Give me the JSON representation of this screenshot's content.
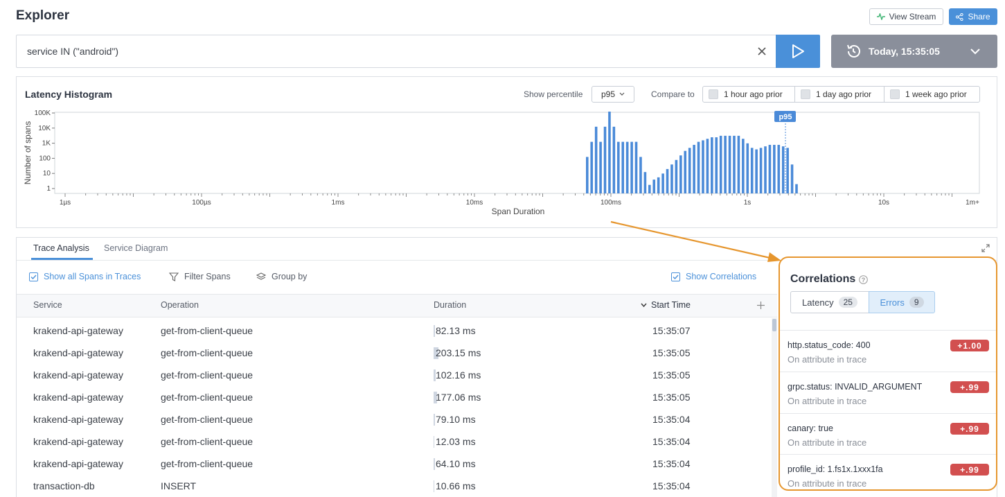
{
  "page": {
    "title": "Explorer"
  },
  "header": {
    "view_stream": "View Stream",
    "share": "Share"
  },
  "query": {
    "value": "service IN (\"android\")"
  },
  "time_range": {
    "label": "Today, 15:35:05"
  },
  "histogram": {
    "title": "Latency Histogram",
    "show_percentile_label": "Show percentile",
    "percentile_value": "p95",
    "compare_label": "Compare to",
    "compare_options": [
      "1 hour ago prior",
      "1 day ago prior",
      "1 week ago prior"
    ],
    "marker_label": "p95",
    "chart_data": {
      "type": "bar",
      "title": "",
      "xlabel": "Span Duration",
      "ylabel": "Number of spans",
      "y_scale": "log",
      "x_scale": "log",
      "y_ticks": [
        "100K",
        "10K",
        "1K",
        "100",
        "10",
        "1"
      ],
      "x_ticks": [
        "1µs",
        "100µs",
        "1ms",
        "10ms",
        "100ms",
        "1s",
        "10s",
        "1m+"
      ],
      "percentile_marker": {
        "label": "p95",
        "x": "≈2.1s"
      },
      "series": [
        {
          "values": [
            2,
            3,
            4,
            3,
            4,
            5,
            4,
            3,
            3,
            3,
            3,
            3,
            2,
            1,
            0.15,
            0.5,
            0.65,
            0.9,
            1.2,
            1.5,
            1.8,
            2.1,
            2.4,
            2.6,
            2.8,
            3.0,
            3.1,
            3.2,
            3.3,
            3.3,
            3.4,
            3.4,
            3.4,
            3.4,
            3.4,
            3.2,
            2.9,
            2.6,
            2.5,
            2.6,
            2.7,
            2.8,
            2.8,
            2.8,
            2.7,
            2.6,
            1.5,
            0.2
          ]
        }
      ]
    }
  },
  "tabs": [
    "Trace Analysis",
    "Service Diagram"
  ],
  "toolbar": {
    "show_all_spans": "Show all Spans in Traces",
    "filter_spans": "Filter Spans",
    "group_by": "Group by",
    "show_correlations": "Show Correlations"
  },
  "table": {
    "columns": {
      "service": "Service",
      "operation": "Operation",
      "duration": "Duration",
      "start_time": "Start Time"
    },
    "rows": [
      {
        "service": "krakend-api-gateway",
        "operation": "get-from-client-queue",
        "duration": "82.13 ms",
        "start_time": "15:35:07"
      },
      {
        "service": "krakend-api-gateway",
        "operation": "get-from-client-queue",
        "duration": "203.15 ms",
        "start_time": "15:35:05"
      },
      {
        "service": "krakend-api-gateway",
        "operation": "get-from-client-queue",
        "duration": "102.16 ms",
        "start_time": "15:35:05"
      },
      {
        "service": "krakend-api-gateway",
        "operation": "get-from-client-queue",
        "duration": "177.06 ms",
        "start_time": "15:35:05"
      },
      {
        "service": "krakend-api-gateway",
        "operation": "get-from-client-queue",
        "duration": "79.10 ms",
        "start_time": "15:35:04"
      },
      {
        "service": "krakend-api-gateway",
        "operation": "get-from-client-queue",
        "duration": "12.03 ms",
        "start_time": "15:35:04"
      },
      {
        "service": "krakend-api-gateway",
        "operation": "get-from-client-queue",
        "duration": "64.10 ms",
        "start_time": "15:35:04"
      },
      {
        "service": "transaction-db",
        "operation": "INSERT",
        "duration": "10.66 ms",
        "start_time": "15:35:04"
      }
    ]
  },
  "correlations": {
    "title": "Correlations",
    "tabs": [
      {
        "label": "Latency",
        "count": "25"
      },
      {
        "label": "Errors",
        "count": "9"
      }
    ],
    "items": [
      {
        "name": "http.status_code: 400",
        "sub": "On attribute in trace",
        "score": "+1.00"
      },
      {
        "name": "grpc.status: INVALID_ARGUMENT",
        "sub": "On attribute in trace",
        "score": "+.99"
      },
      {
        "name": "canary: true",
        "sub": "On attribute in trace",
        "score": "+.99"
      },
      {
        "name": "profile_id: 1.fs1x.1xxx1fa",
        "sub": "On attribute in trace",
        "score": "+.99"
      }
    ]
  },
  "colors": {
    "accent": "#4a90d9",
    "bar": "#4a8ad8",
    "highlight": "#e6962e",
    "badge": "#d24f4f"
  }
}
